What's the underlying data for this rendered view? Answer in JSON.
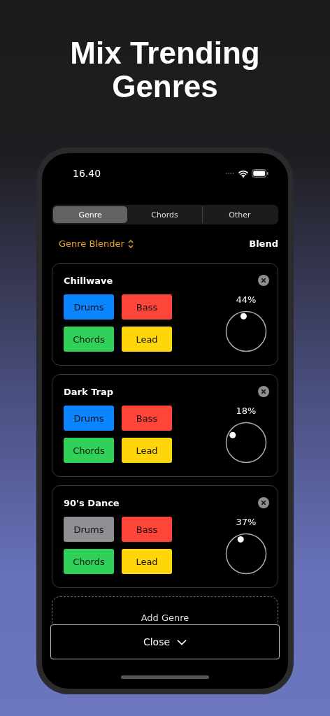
{
  "headline": "Mix Trending Genres",
  "status_bar": {
    "time": "16.40"
  },
  "tabs": [
    {
      "label": "Genre",
      "selected": true
    },
    {
      "label": "Chords",
      "selected": false
    },
    {
      "label": "Other",
      "selected": false
    }
  ],
  "header": {
    "picker": "Genre Blender",
    "action": "Blend"
  },
  "genres": [
    {
      "name": "Chillwave",
      "reading": "44%",
      "level": 0.44,
      "pads": [
        {
          "label": "Drums",
          "color": "#0a84ff",
          "on": true
        },
        {
          "label": "Bass",
          "color": "#ff453a",
          "on": true
        },
        {
          "label": "Chords",
          "color": "#30d158",
          "on": true
        },
        {
          "label": "Lead",
          "color": "#ffd60a",
          "on": true
        }
      ]
    },
    {
      "name": "Dark Trap",
      "reading": "18%",
      "level": 0.18,
      "pads": [
        {
          "label": "Drums",
          "color": "#0a84ff",
          "on": true
        },
        {
          "label": "Bass",
          "color": "#ff453a",
          "on": true
        },
        {
          "label": "Chords",
          "color": "#30d158",
          "on": true
        },
        {
          "label": "Lead",
          "color": "#ffd60a",
          "on": true
        }
      ]
    },
    {
      "name": "90's Dance",
      "reading": "37%",
      "level": 0.37,
      "pads": [
        {
          "label": "Drums",
          "on": false
        },
        {
          "label": "Bass",
          "color": "#ff453a",
          "on": true
        },
        {
          "label": "Chords",
          "color": "#30d158",
          "on": true
        },
        {
          "label": "Lead",
          "color": "#ffd60a",
          "on": true
        }
      ]
    }
  ],
  "add_button": "Add Genre",
  "close_button": "Close"
}
